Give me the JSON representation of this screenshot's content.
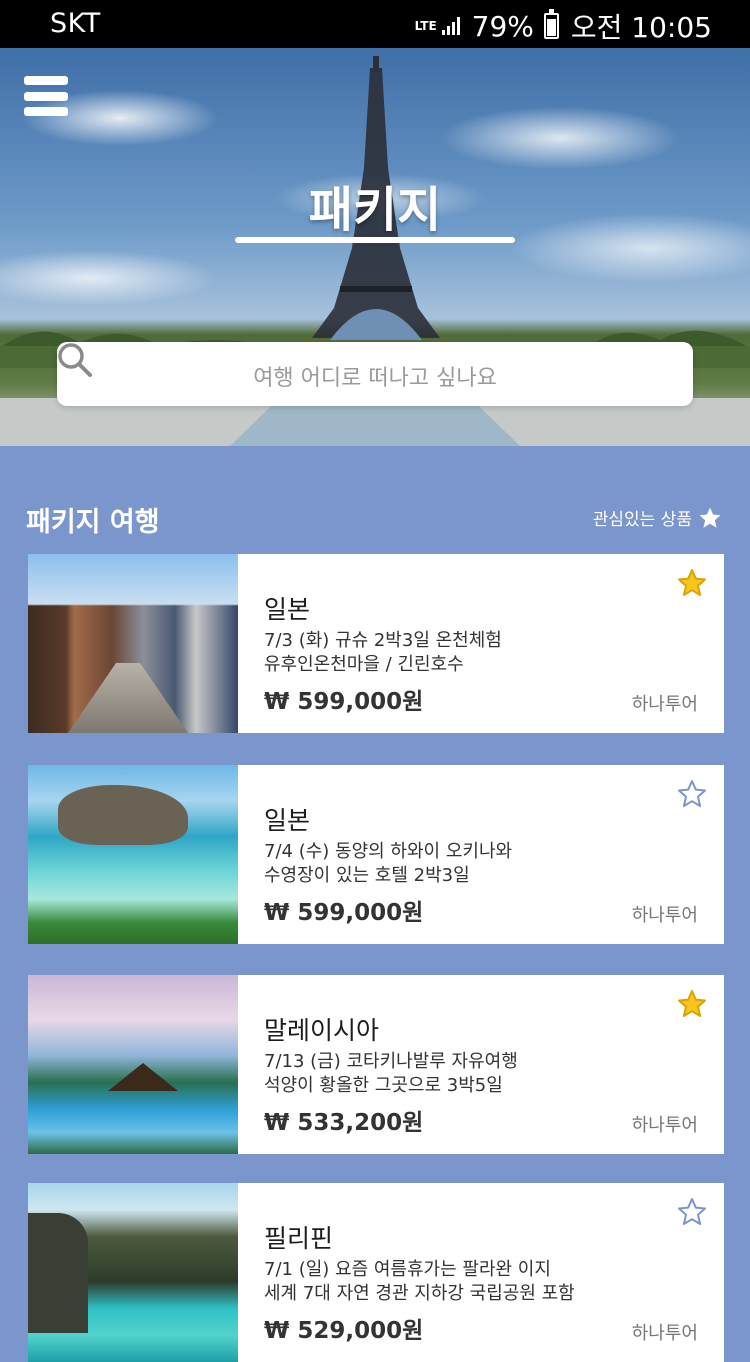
{
  "status_bar": {
    "carrier": "SKT",
    "network": "LTE",
    "battery_percent": "79%",
    "battery_level": 0.79,
    "time": "오전 10:05"
  },
  "header": {
    "title": "패키지",
    "menu_icon": "hamburger-menu-icon",
    "search": {
      "placeholder": "여행 어디로 떠나고 싶나요",
      "icon": "search-icon"
    }
  },
  "section": {
    "title": "패키지 여행",
    "favorites_label": "관심있는 상품",
    "favorites_icon": "star-icon"
  },
  "colors": {
    "page_background": "#7b95cd",
    "star_filled": "#f7c51e",
    "star_outline": "#7b95cd"
  },
  "packages": [
    {
      "destination": "일본",
      "line1": "7/3 (화) 규슈 2박3일  온천체험",
      "line2": "유후인온천마을 / 긴린호수",
      "price": "₩ 599,000원",
      "agency": "하나투어",
      "favorited": true
    },
    {
      "destination": "일본",
      "line1": "7/4 (수)  동양의 하와이 오키나와",
      "line2": "수영장이 있는 호텔 2박3일",
      "price": "₩ 599,000원",
      "agency": "하나투어",
      "favorited": false
    },
    {
      "destination": "말레이시아",
      "line1": "7/13 (금) 코타키나발루 자유여행",
      "line2": "석양이 황올한 그곳으로 3박5일",
      "price": "₩ 533,200원",
      "agency": "하나투어",
      "favorited": true
    },
    {
      "destination": "필리핀",
      "line1": "7/1 (일) 요즘 여름휴가는 팔라완 이지",
      "line2": "세계 7대 자연 경관 지하강 국립공원 포함",
      "price": "₩ 529,000원",
      "agency": "하나투어",
      "favorited": false
    }
  ]
}
